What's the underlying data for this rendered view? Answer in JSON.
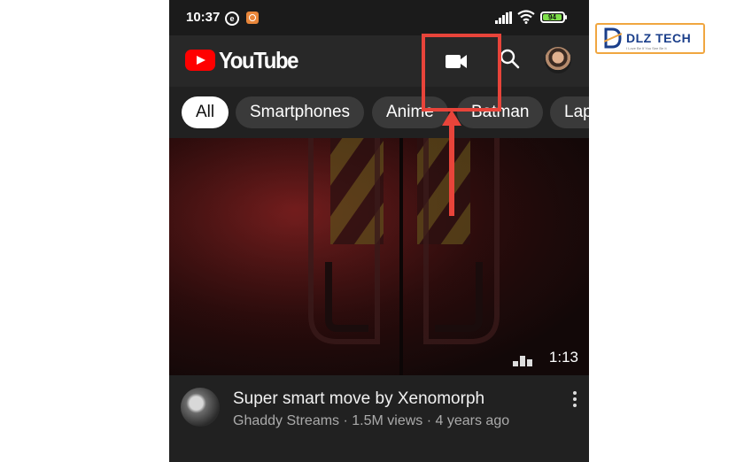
{
  "status_bar": {
    "time": "10:37",
    "e_icon": "e",
    "battery": "94",
    "battery_level": 0.94
  },
  "app": {
    "logo_word": "YouTube",
    "brand_color": "#ff0000",
    "icons": [
      "camera-icon",
      "search-icon"
    ]
  },
  "chips": [
    "All",
    "Smartphones",
    "Anime",
    "Batman",
    "Lap"
  ],
  "video": {
    "duration": "1:13",
    "title": "Super smart move by Xenomorph",
    "subtitle": "Ghaddy Streams · 1.5M views · 4 years ago"
  },
  "annotation": {
    "highlight_color": "#e8443a"
  },
  "watermark": {
    "text": "DLZ TECH",
    "tagline": "I Love Be If You See Be It"
  }
}
